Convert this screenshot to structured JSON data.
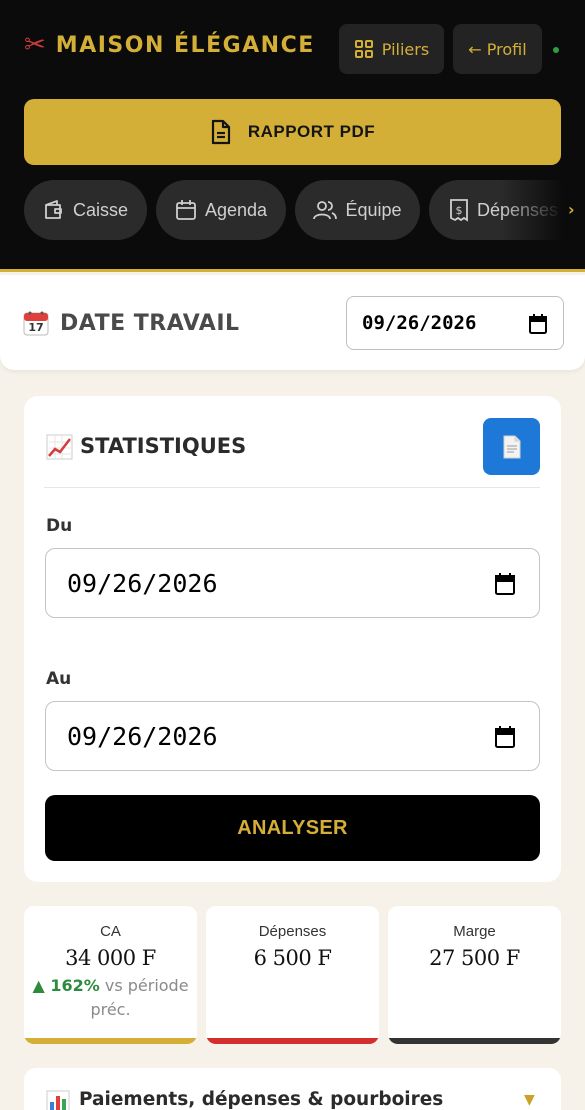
{
  "header": {
    "brand": "MAISON ÉLÉGANCE",
    "piliers_label": "Piliers",
    "profil_label": "← Profil",
    "pdf_label": "RAPPORT PDF",
    "tabs": [
      {
        "label": "Caisse",
        "icon": "wallet-icon"
      },
      {
        "label": "Agenda",
        "icon": "calendar-icon"
      },
      {
        "label": "Équipe",
        "icon": "users-icon"
      },
      {
        "label": "Dépenses",
        "icon": "receipt-icon"
      }
    ],
    "scroll_arrow": "›"
  },
  "work_date": {
    "label": "DATE TRAVAIL",
    "value": "09/26/2026"
  },
  "stats": {
    "title": "STATISTIQUES",
    "from_label": "Du",
    "from_value": "09/26/2026",
    "to_label": "Au",
    "to_value": "09/26/2026",
    "analyse_label": "ANALYSER"
  },
  "kpis": [
    {
      "label": "CA",
      "value": "34 000 F",
      "delta": "▲ 162%",
      "delta_suffix": "vs période préc.",
      "color": "#d4af37"
    },
    {
      "label": "Dépenses",
      "value": "6 500 F",
      "color": "#d32f2f"
    },
    {
      "label": "Marge",
      "value": "27 500 F",
      "color": "#333333"
    }
  ],
  "accordion": {
    "title": "Paiements, dépenses & pourboires",
    "arrow": "▼"
  },
  "colors": {
    "gold": "#d4af37",
    "dark": "#0b0b0b",
    "blue": "#1e78d7",
    "green": "#2e8b3e",
    "red": "#d32f2f"
  }
}
